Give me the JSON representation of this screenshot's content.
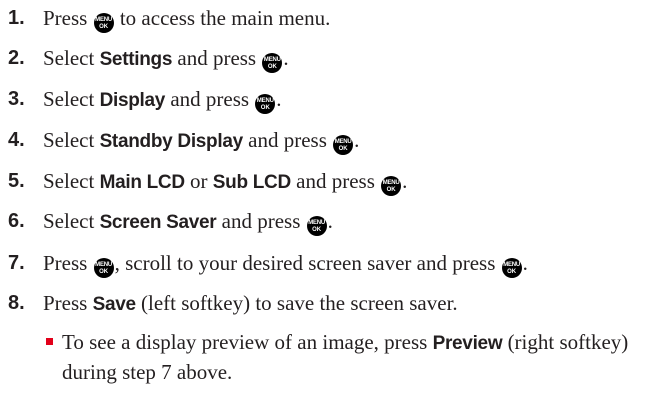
{
  "steps": [
    {
      "num": "1.",
      "parts": [
        {
          "t": "Press "
        },
        {
          "k": "MENU OK"
        },
        {
          "t": " to access the main menu."
        }
      ]
    },
    {
      "num": "2.",
      "parts": [
        {
          "t": "Select "
        },
        {
          "b": "Settings"
        },
        {
          "t": " and press "
        },
        {
          "k": "MENU OK"
        },
        {
          "t": "."
        }
      ]
    },
    {
      "num": "3.",
      "parts": [
        {
          "t": "Select "
        },
        {
          "b": "Display"
        },
        {
          "t": " and press "
        },
        {
          "k": "MENU OK"
        },
        {
          "t": "."
        }
      ]
    },
    {
      "num": "4.",
      "parts": [
        {
          "t": "Select "
        },
        {
          "b": "Standby Display"
        },
        {
          "t": " and press "
        },
        {
          "k": "MENU OK"
        },
        {
          "t": "."
        }
      ]
    },
    {
      "num": "5.",
      "parts": [
        {
          "t": "Select "
        },
        {
          "b": "Main LCD"
        },
        {
          "t": " or "
        },
        {
          "b": "Sub LCD"
        },
        {
          "t": " and press "
        },
        {
          "k": "MENU OK"
        },
        {
          "t": "."
        }
      ]
    },
    {
      "num": "6.",
      "parts": [
        {
          "t": "Select "
        },
        {
          "b": "Screen Saver"
        },
        {
          "t": " and press "
        },
        {
          "k": "MENU OK"
        },
        {
          "t": "."
        }
      ]
    },
    {
      "num": "7.",
      "parts": [
        {
          "t": "Press "
        },
        {
          "k": "MENU OK"
        },
        {
          "t": ", scroll to your desired screen saver and press "
        },
        {
          "k": "MENU OK"
        },
        {
          "t": "."
        }
      ]
    },
    {
      "num": "8.",
      "parts": [
        {
          "t": "Press "
        },
        {
          "b": "Save"
        },
        {
          "t": " (left softkey) to save the screen saver."
        }
      ]
    }
  ],
  "note": {
    "parts": [
      {
        "t": "To see a display preview of an image, press "
      },
      {
        "b": "Preview"
      },
      {
        "t": " (right softkey) during step 7 above."
      }
    ]
  },
  "menu_key_icon": "menu-ok-key-icon",
  "bullet_color": "#e2001a"
}
